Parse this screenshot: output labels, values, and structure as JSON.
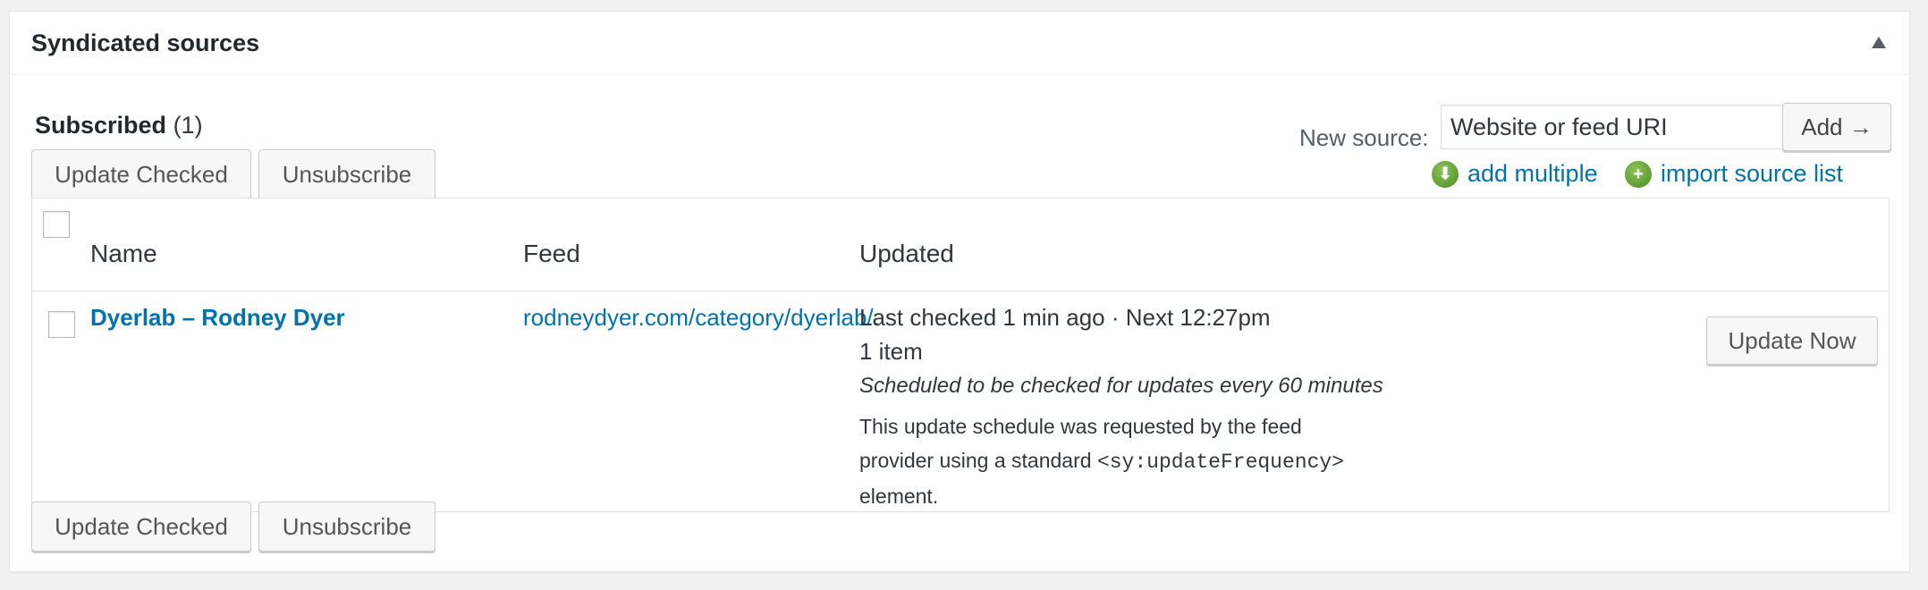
{
  "box": {
    "title": "Syndicated sources"
  },
  "subscribed": {
    "label": "Subscribed",
    "count": "(1)"
  },
  "actions": {
    "update_checked": "Update Checked",
    "unsubscribe": "Unsubscribe"
  },
  "new_source": {
    "label": "New source:",
    "placeholder": "Website or feed URI",
    "add_button": "Add →",
    "add_multiple": "add multiple",
    "import_list": "import source list"
  },
  "table": {
    "columns": [
      "Name",
      "Feed",
      "Updated"
    ],
    "rows": [
      {
        "name": "Dyerlab – Rodney Dyer",
        "feed": "rodneydyer.com/category/dyerlab/.",
        "last_checked": "Last checked 1 min ago · Next 12:27pm",
        "items": "1 item",
        "schedule": "Scheduled to be checked for updates every 60 minutes",
        "note_before": "This update schedule was requested by the feed provider using a standard ",
        "note_code": "<sy:updateFrequency>",
        "note_after": " element.",
        "update_now": "Update Now"
      }
    ]
  },
  "icons": {
    "collapse": "triangle-up-icon",
    "add_multiple": "green-download-icon",
    "import_list": "green-plus-icon"
  },
  "colors": {
    "link": "#0073aa",
    "icon_green": "#4a8b1f"
  }
}
